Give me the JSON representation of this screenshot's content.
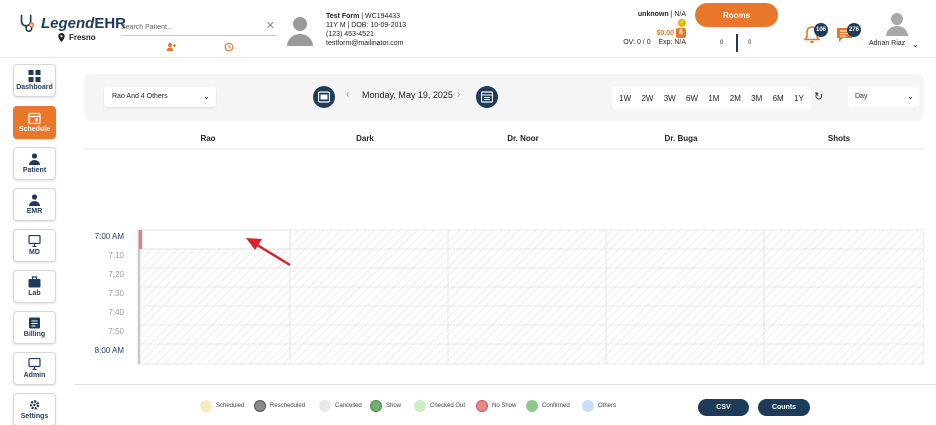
{
  "brand": {
    "name_part1": "Legend",
    "name_part2": "EHR",
    "location": "Fresno"
  },
  "search": {
    "placeholder": "Search Patient..."
  },
  "patient": {
    "name": "Test Form",
    "id": "WC194433",
    "demographics": "11Y M | DOB: 10-09-2013",
    "phone": "(123) 453-4521",
    "email": "testform@mailinator.com"
  },
  "balance": {
    "status": "unknown",
    "status_value": "N/A",
    "amount": "$0.00",
    "ov": "OV: 0 / 0",
    "exp": "Exp: N/A"
  },
  "rooms": {
    "label": "Rooms",
    "left_count": "0",
    "right_count": "0"
  },
  "notifications": {
    "bell_count": "106",
    "chat_count": "276"
  },
  "user": {
    "name": "Adnan Riaz"
  },
  "sidebar": {
    "items": [
      {
        "label": "Dashboard",
        "icon": "dashboard-icon"
      },
      {
        "label": "Schedule",
        "icon": "calendar-icon",
        "active": true
      },
      {
        "label": "Patient",
        "icon": "person-icon"
      },
      {
        "label": "EMR",
        "icon": "person-icon"
      },
      {
        "label": "MD",
        "icon": "monitor-icon"
      },
      {
        "label": "Lab",
        "icon": "briefcase-icon"
      },
      {
        "label": "Billing",
        "icon": "billing-icon"
      },
      {
        "label": "Admin",
        "icon": "monitor-icon"
      },
      {
        "label": "Settings",
        "icon": "gear-icon"
      }
    ]
  },
  "toolbar": {
    "provider_filter": "Rao And 4 Others",
    "date": "Monday, May 19, 2025",
    "ranges": [
      "1W",
      "2W",
      "3W",
      "6W",
      "1M",
      "2M",
      "3M",
      "6M",
      "1Y"
    ],
    "view": "Day"
  },
  "schedule": {
    "columns": [
      "Rao",
      "Dark",
      "Dr. Noor",
      "Dr. Buga",
      "Shots"
    ],
    "times": [
      {
        "label": "7:00 AM",
        "hour": true
      },
      {
        "label": "7:10",
        "hour": false
      },
      {
        "label": "7:20",
        "hour": false
      },
      {
        "label": "7:30",
        "hour": false
      },
      {
        "label": "7:40",
        "hour": false
      },
      {
        "label": "7:50",
        "hour": false
      },
      {
        "label": "8:00 AM",
        "hour": true
      }
    ]
  },
  "legend": [
    {
      "label": "Scheduled",
      "color": "#fbe9c4"
    },
    {
      "label": "Rescheduled",
      "color": "#8a8a8a"
    },
    {
      "label": "Cancelled",
      "color": "#e9e9e9"
    },
    {
      "label": "Show",
      "color": "#6db26a"
    },
    {
      "label": "Checked Out",
      "color": "#c8f0c0"
    },
    {
      "label": "No Show",
      "color": "#e78a8a"
    },
    {
      "label": "Confirmed",
      "color": "#8fc78c"
    },
    {
      "label": "Others",
      "color": "#c9def7"
    }
  ],
  "footer": {
    "csv_label": "CSV",
    "counts_label": "Counts"
  },
  "colors": {
    "brand_navy": "#1f3b5a",
    "accent_orange": "#e8762b"
  }
}
